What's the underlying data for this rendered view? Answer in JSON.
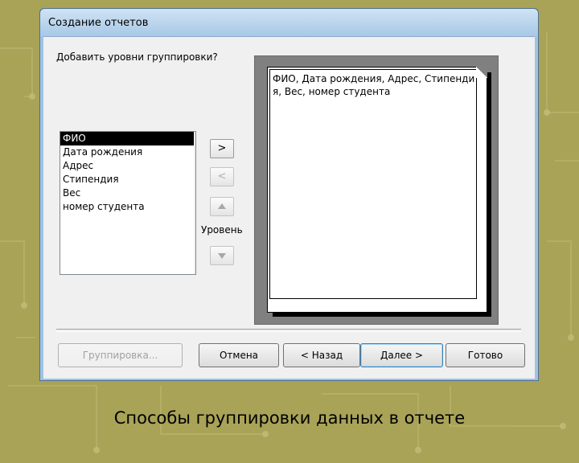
{
  "window": {
    "title": "Создание отчетов"
  },
  "prompt": "Добавить уровни группировки?",
  "fields": [
    {
      "label": "ФИО",
      "selected": true
    },
    {
      "label": "Дата рождения",
      "selected": false
    },
    {
      "label": "Адрес",
      "selected": false
    },
    {
      "label": "Стипендия",
      "selected": false
    },
    {
      "label": "Вес",
      "selected": false
    },
    {
      "label": "номер студента",
      "selected": false
    }
  ],
  "controls": {
    "add_label": ">",
    "remove_label": "<",
    "level_label": "Уровень",
    "priority_up_icon": "up-arrow-icon",
    "priority_down_icon": "down-arrow-icon"
  },
  "preview": {
    "text": "ФИО, Дата рождения, Адрес, Стипендия, Вес, номер студента"
  },
  "buttons": {
    "grouping": "Группировка...",
    "cancel": "Отмена",
    "back": "< Назад",
    "next": "Далее >",
    "finish": "Готово"
  },
  "caption": "Способы группировки данных в отчете",
  "colors": {
    "background": "#a9a358",
    "selection": "#000000",
    "preview_frame": "#808080"
  }
}
